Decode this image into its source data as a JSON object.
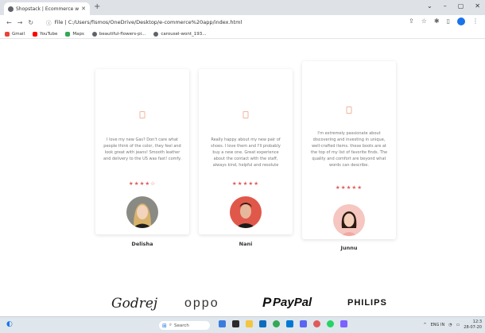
{
  "browser": {
    "tab_title": "Shopstack | Ecommerce website",
    "url": "File | C:/Users/fismos/OneDrive/Desktop/e-commerce%20app/index.html",
    "url_info": "ⓘ",
    "bookmarks": [
      "Gmail",
      "YouTube",
      "Maps",
      "beautiful-flowers-pi...",
      "carousel-wont_193..."
    ]
  },
  "testimonials": [
    {
      "text": "I love my new Gas? Don't care what people think of the color, they feel and look great with jeans! Smooth leather and delivery to the US was fast! comfy.",
      "stars": "★★★★☆",
      "rating": 4,
      "name": "Delisha"
    },
    {
      "text": "Really happy about my new pair of shoes. I love them and I'll probably buy a new one. Great experience about the contact with the staff, always kind, helpful and resolute",
      "stars": "★★★★★",
      "rating": 5,
      "name": "Nani"
    },
    {
      "text": "I'm extremely passionate about discovering and investing in unique, well-crafted items. these boots are at the top of my list of favorite finds. The quality and comfort are beyond what words can describe.",
      "stars": "★★★★★",
      "rating": 5,
      "name": "Junnu"
    }
  ],
  "brands": [
    "Godrej",
    "oppo",
    "PayPal",
    "PHILIPS"
  ],
  "taskbar": {
    "search_label": "Search",
    "lang": "ENG IN",
    "time": "12:3",
    "date": "28-07-20"
  },
  "colors": {
    "accent": "#e05a5a",
    "quote_icon": "#f0b59e"
  }
}
